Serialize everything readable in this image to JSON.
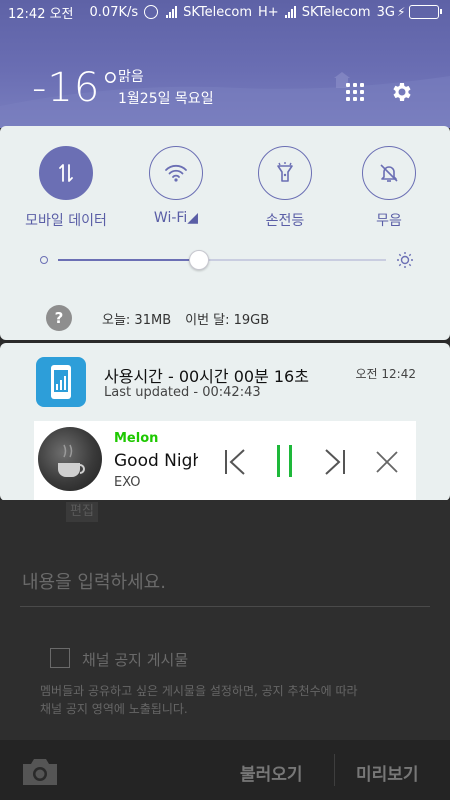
{
  "statusbar": {
    "time": "12:42 오전",
    "net_speed": "0.07K/s",
    "carrier1": "SKTelecom",
    "net1": "H+",
    "carrier2": "SKTelecom",
    "net2": "3G",
    "battery_level": 1.0
  },
  "weather": {
    "temperature": "-16°",
    "condition": "맑음",
    "date": "1월25일 목요일"
  },
  "quick_settings": {
    "toggles": [
      {
        "label": "모바일 데이터",
        "icon": "mobile-data-icon",
        "active": true
      },
      {
        "label": "Wi-Fi◢",
        "icon": "wifi-icon",
        "active": false
      },
      {
        "label": "손전등",
        "icon": "flashlight-icon",
        "active": false
      },
      {
        "label": "무음",
        "icon": "bell-off-icon",
        "active": false
      }
    ],
    "brightness_level": 0.43,
    "usage_today": "오늘: 31MB",
    "usage_month": "이번 달: 19GB"
  },
  "notification": {
    "title": "사용시간 - 00시간 00분 16초",
    "subtitle": "Last updated - 00:42:43",
    "time": "오전 12:42"
  },
  "player": {
    "app_logo": "Melon",
    "song": "Good Night",
    "artist": "EXO"
  },
  "background_app": {
    "edit_tag": "편집",
    "content_placeholder": "내용을 입력하세요.",
    "notice_label": "채널 공지 게시물",
    "notice_desc": "멤버들과 공유하고 싶은 게시물을 설정하면, 공지 추천수에 따라 채널 공지 영역에 노출됩니다.",
    "load_button": "불러오기",
    "preview_button": "미리보기"
  },
  "colors": {
    "accent": "#6b6fb4",
    "melon_green": "#1ec800",
    "pause_green": "#1eb83a",
    "app_icon_blue": "#2d9ed9"
  }
}
